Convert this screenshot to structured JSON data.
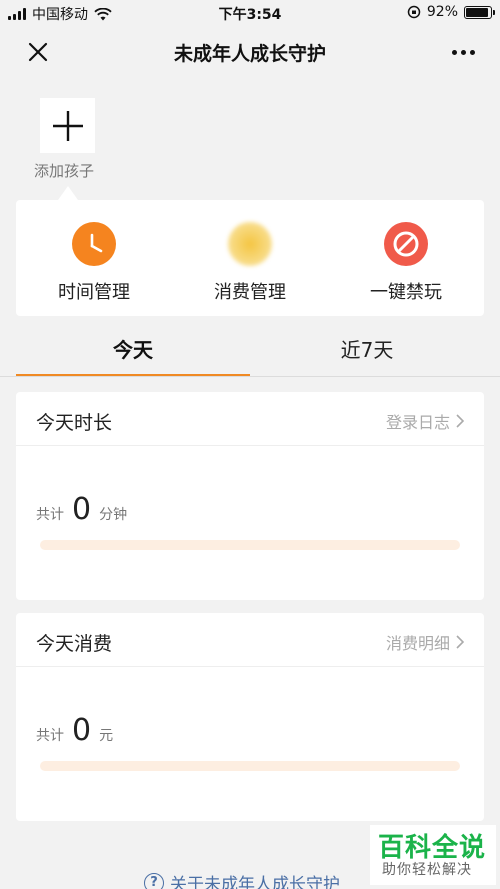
{
  "status_bar": {
    "carrier": "中国移动",
    "time": "下午3:54",
    "battery": "92%",
    "battery_level": 0.92
  },
  "nav": {
    "title": "未成年人成长守护"
  },
  "add_child": {
    "label": "添加孩子"
  },
  "functions": [
    {
      "label": "时间管理",
      "icon": "clock-icon",
      "color": "#f5841f"
    },
    {
      "label": "消费管理",
      "icon": "coin-icon",
      "color": "#f4c542"
    },
    {
      "label": "一键禁玩",
      "icon": "forbidden-icon",
      "color": "#f05a4a"
    }
  ],
  "tabs": [
    {
      "label": "今天",
      "active": true
    },
    {
      "label": "近7天",
      "active": false
    }
  ],
  "time_card": {
    "title": "今天时长",
    "link": "登录日志",
    "total_label": "共计",
    "value": "0",
    "unit": "分钟",
    "progress": 0
  },
  "spend_card": {
    "title": "今天消费",
    "link": "消费明细",
    "total_label": "共计",
    "value": "0",
    "unit": "元",
    "progress": 0
  },
  "about": {
    "label": "关于未成年人成长守护"
  },
  "watermark": {
    "main": "百科全说",
    "sub": "助你轻松解决"
  },
  "colors": {
    "accent": "#f08a24",
    "link": "#4a6fa5",
    "brand_green": "#1bb34a"
  }
}
